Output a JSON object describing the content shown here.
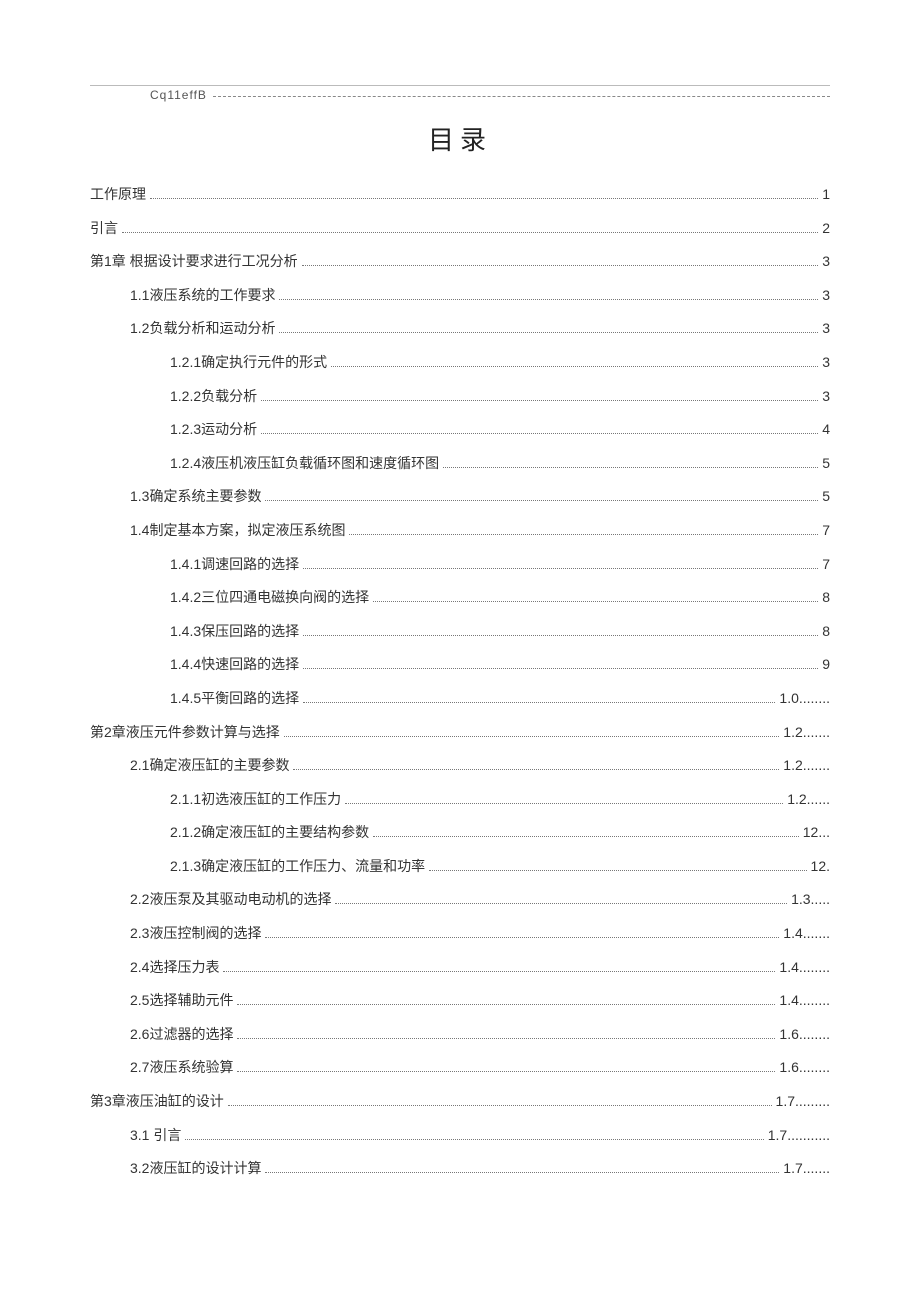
{
  "header_code": "Cq11effB",
  "title": "目录",
  "toc": [
    {
      "label": "工作原理",
      "page": "1",
      "level": 0
    },
    {
      "label": "引言",
      "page": "2",
      "level": 0
    },
    {
      "label": "第1章 根据设计要求进行工况分析",
      "page": "3",
      "level": 0
    },
    {
      "label": "1.1液压系统的工作要求",
      "page": "3",
      "level": 1
    },
    {
      "label": "1.2负载分析和运动分析",
      "page": "3",
      "level": 1
    },
    {
      "label": "1.2.1确定执行元件的形式",
      "page": "3",
      "level": 2
    },
    {
      "label": "1.2.2负载分析",
      "page": "3",
      "level": 2
    },
    {
      "label": "1.2.3运动分析",
      "page": "4",
      "level": 2
    },
    {
      "label": "1.2.4液压机液压缸负载循环图和速度循环图",
      "page": "5",
      "level": 2
    },
    {
      "label": "1.3确定系统主要参数",
      "page": "5",
      "level": 1
    },
    {
      "label": "1.4制定基本方案，拟定液压系统图",
      "page": "7",
      "level": 1
    },
    {
      "label": "1.4.1调速回路的选择",
      "page": "7",
      "level": 2
    },
    {
      "label": "1.4.2三位四通电磁换向阀的选择",
      "page": "8",
      "level": 2
    },
    {
      "label": "1.4.3保压回路的选择",
      "page": "8",
      "level": 2
    },
    {
      "label": "1.4.4快速回路的选择",
      "page": "9",
      "level": 2
    },
    {
      "label": "1.4.5平衡回路的选择",
      "page": "1.0........",
      "level": 2
    },
    {
      "label": "第2章液压元件参数计算与选择",
      "page": "1.2.......",
      "level": 0
    },
    {
      "label": "2.1确定液压缸的主要参数",
      "page": "1.2.......",
      "level": 1
    },
    {
      "label": "2.1.1初选液压缸的工作压力",
      "page": "1.2......",
      "level": 2
    },
    {
      "label": "2.1.2确定液压缸的主要结构参数",
      "page": "12...",
      "level": 2
    },
    {
      "label": "2.1.3确定液压缸的工作压力、流量和功率",
      "page": "12.",
      "level": 2
    },
    {
      "label": "2.2液压泵及其驱动电动机的选择",
      "page": "1.3.....",
      "level": 1
    },
    {
      "label": "2.3液压控制阀的选择",
      "page": "1.4.......",
      "level": 1
    },
    {
      "label": "2.4选择压力表",
      "page": "1.4........",
      "level": 1
    },
    {
      "label": "2.5选择辅助元件",
      "page": "1.4........",
      "level": 1
    },
    {
      "label": "2.6过滤器的选择",
      "page": "1.6........",
      "level": 1
    },
    {
      "label": "2.7液压系统验算",
      "page": "1.6........",
      "level": 1
    },
    {
      "label": "第3章液压油缸的设计",
      "page": "1.7.........",
      "level": 0
    },
    {
      "label": "3.1   引言",
      "page": "1.7...........",
      "level": 1
    },
    {
      "label": "3.2液压缸的设计计算",
      "page": "1.7.......",
      "level": 1
    }
  ]
}
